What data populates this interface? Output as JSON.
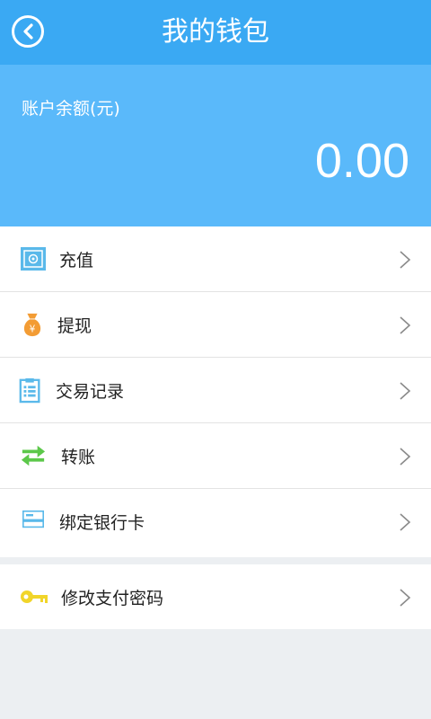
{
  "header": {
    "title": "我的钱包",
    "back_icon": "chevron-left-icon"
  },
  "balance": {
    "label": "账户余额(元)",
    "value": "0.00"
  },
  "menu": [
    {
      "label": "充值",
      "icon": "safe-icon"
    },
    {
      "label": "提现",
      "icon": "money-bag-icon"
    },
    {
      "label": "交易记录",
      "icon": "clipboard-list-icon"
    },
    {
      "label": "转账",
      "icon": "transfer-arrows-icon"
    },
    {
      "label": "绑定银行卡",
      "icon": "bank-card-icon"
    }
  ],
  "menu2": [
    {
      "label": "修改支付密码",
      "icon": "key-icon"
    }
  ],
  "colors": {
    "header": "#3aa9f3",
    "balance_bg": "#5ab9fa",
    "page_bg": "#eceff2",
    "icon_blue": "#5ab9ea",
    "icon_orange": "#f39c34",
    "icon_green": "#5cc84a",
    "icon_yellow": "#f1d52a"
  }
}
